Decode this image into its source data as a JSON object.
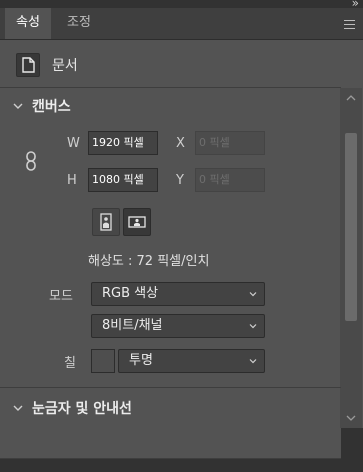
{
  "window": {
    "collapse_glyph": "»"
  },
  "tabs": [
    {
      "label": "속성",
      "active": true
    },
    {
      "label": "조정",
      "active": false
    }
  ],
  "document": {
    "label": "문서",
    "icon": "document-icon"
  },
  "canvas": {
    "title": "캔버스",
    "width_label": "W",
    "width_value": "1920 픽셀",
    "height_label": "H",
    "height_value": "1080 픽셀",
    "x_label": "X",
    "x_placeholder": "0 픽셀",
    "y_label": "Y",
    "y_placeholder": "0 픽셀",
    "resolution": "해상도 : 72 픽셀/인치",
    "mode_label": "모드",
    "mode_value": "RGB 색상",
    "depth_value": "8비트/채널",
    "fill_label": "칠",
    "fill_value": "투명"
  },
  "guides": {
    "title": "눈금자 및 안내선"
  },
  "colors": {
    "panel_bg": "#535353",
    "tabbar_bg": "#3f3f3f",
    "field_bg": "#434343",
    "text": "#e6e6e6"
  }
}
